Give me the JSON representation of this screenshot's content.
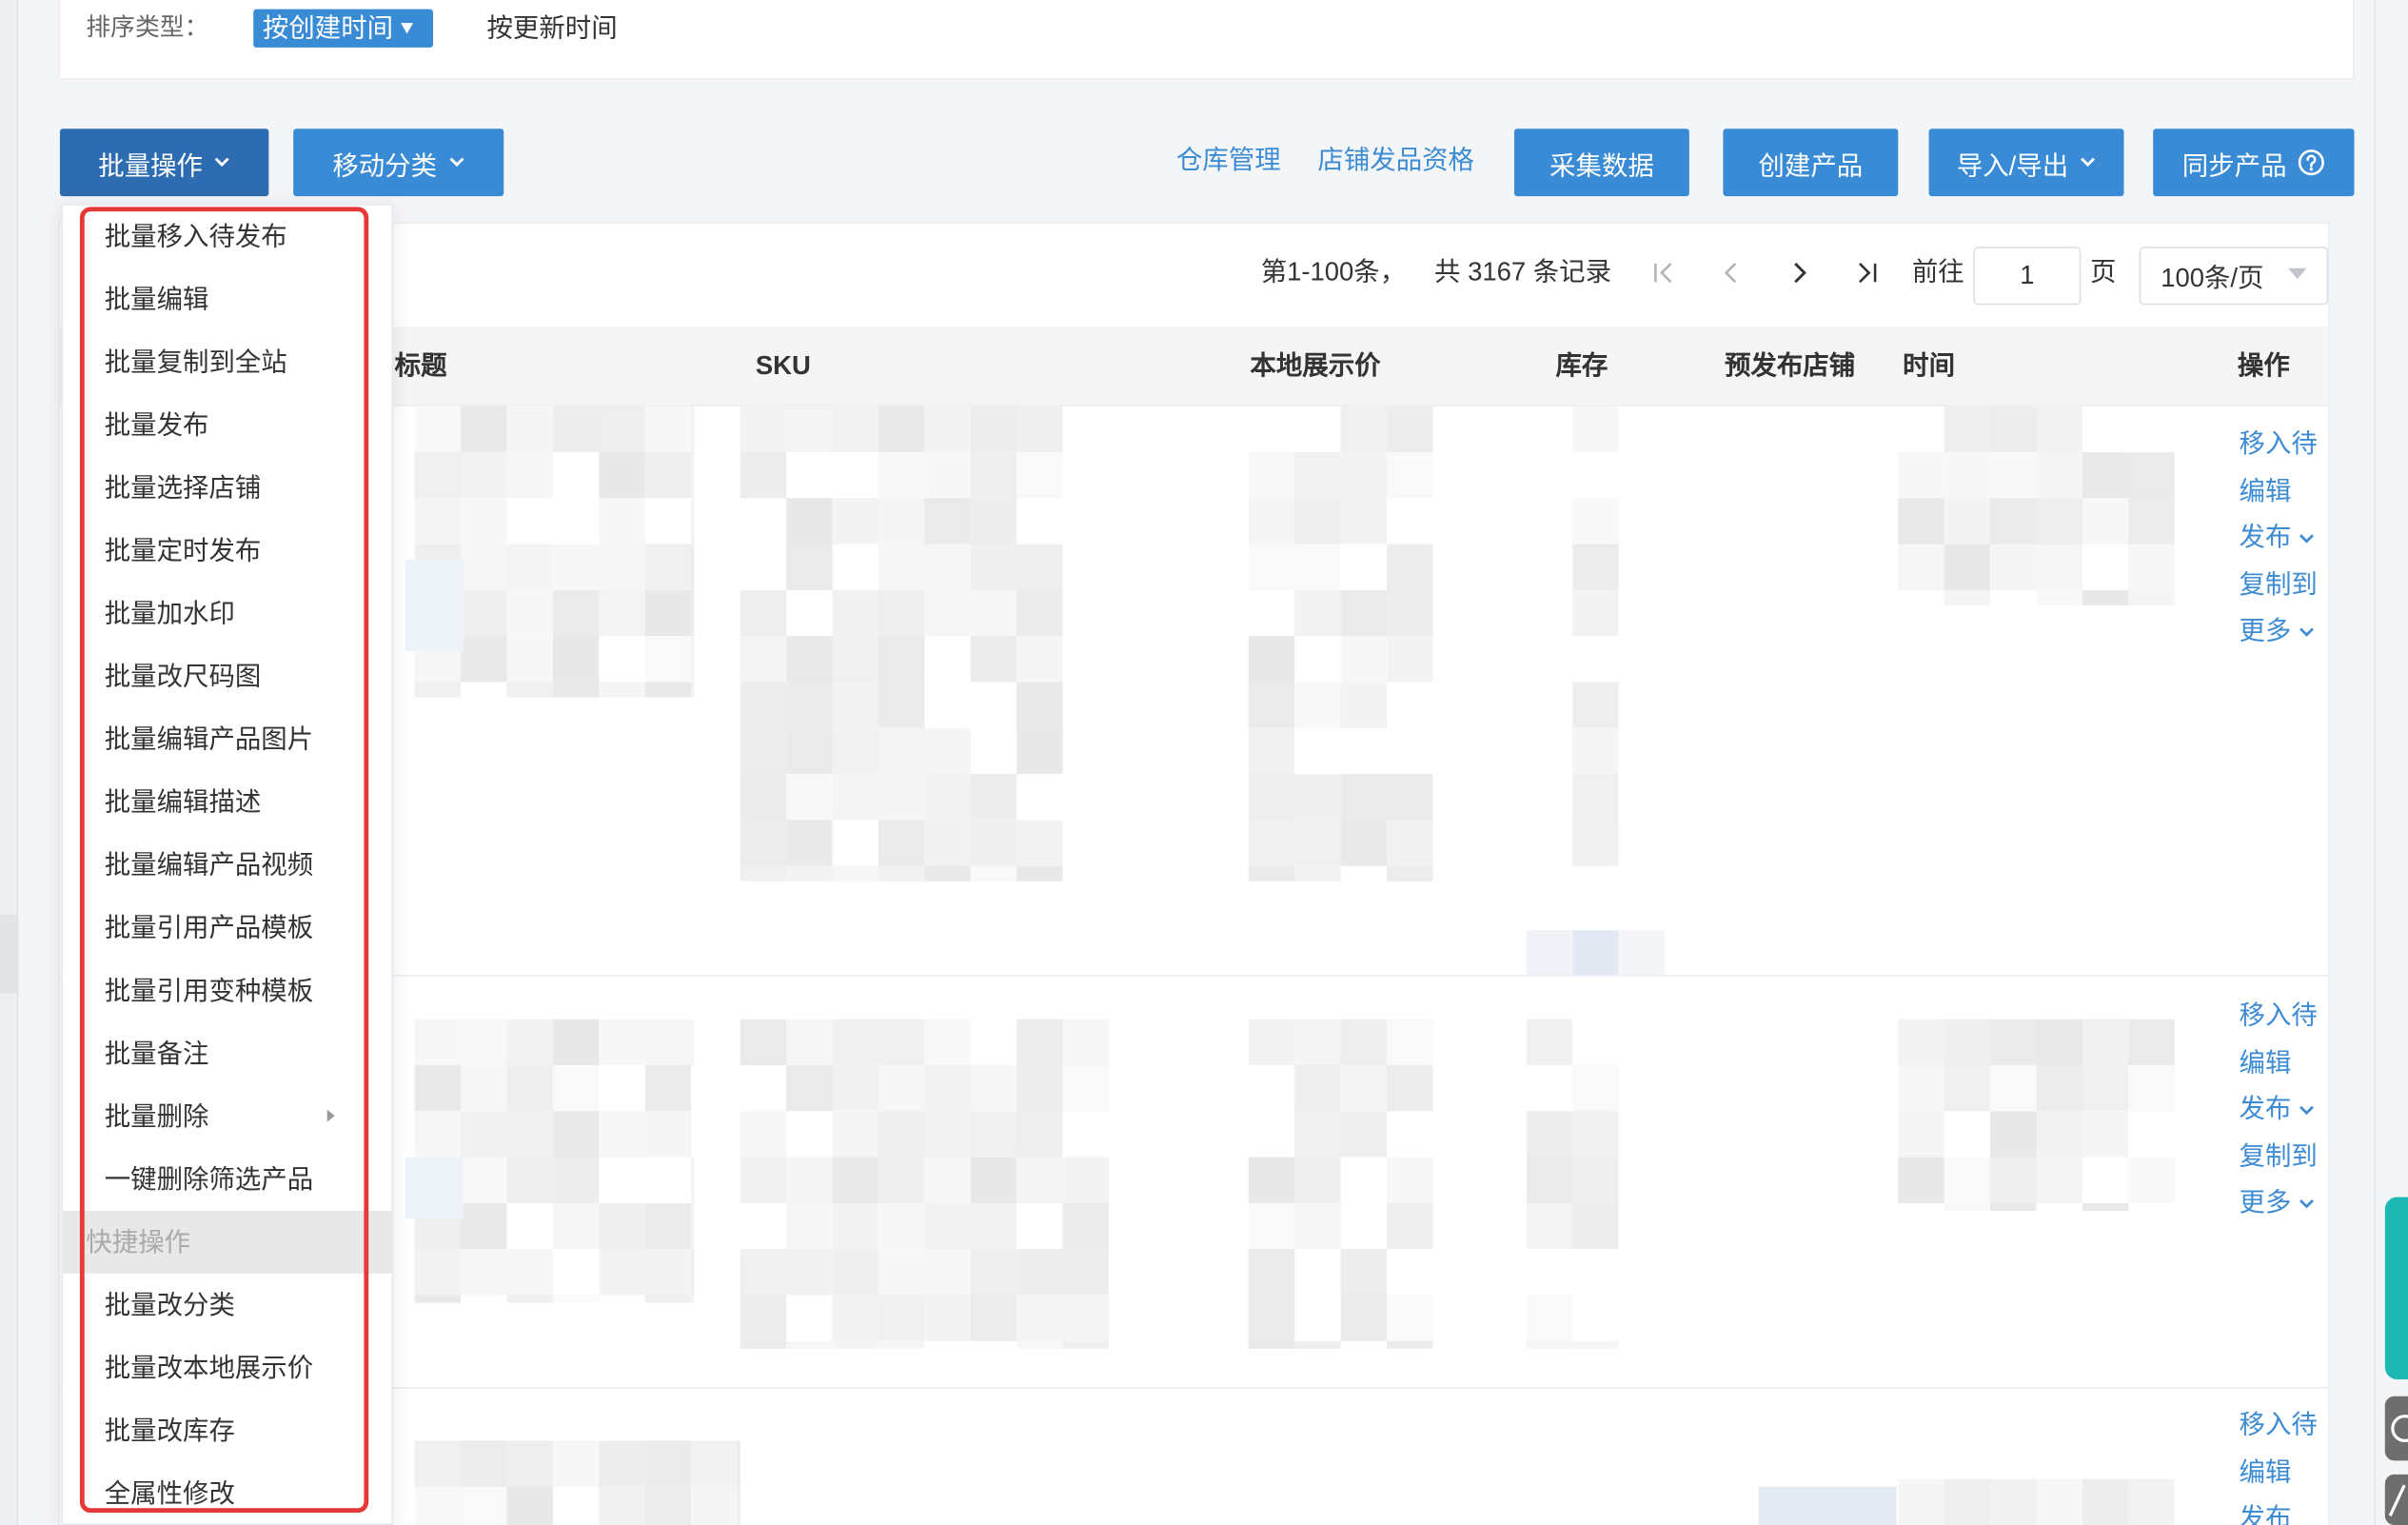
{
  "sort": {
    "label": "排序类型：",
    "active": "按创建时间",
    "other": "按更新时间"
  },
  "toolbar": {
    "batch_ops": "批量操作",
    "move_category": "移动分类",
    "warehouse_link": "仓库管理",
    "store_qualification_link": "店铺发品资格",
    "collect_data": "采集数据",
    "create_product": "创建产品",
    "import_export": "导入/导出",
    "sync_products": "同步产品"
  },
  "pagination": {
    "range": "第1-100条，",
    "total": "共 3167 条记录",
    "goto_label": "前往",
    "page_value": "1",
    "page_unit": "页",
    "page_size": "100条/页"
  },
  "table": {
    "columns": [
      "标题",
      "SKU",
      "本地展示价",
      "库存",
      "预发布店铺",
      "时间",
      "操作"
    ]
  },
  "row_actions": [
    {
      "move": "移入待",
      "edit": "编辑",
      "publish": "发布",
      "copy": "复制到",
      "more": "更多"
    },
    {
      "move": "移入待",
      "edit": "编辑",
      "publish": "发布",
      "copy": "复制到",
      "more": "更多"
    },
    {
      "move": "移入待",
      "edit": "编辑",
      "publish": "发布"
    }
  ],
  "batch_menu": {
    "items": [
      "批量移入待发布",
      "批量编辑",
      "批量复制到全站",
      "批量发布",
      "批量选择店铺",
      "批量定时发布",
      "批量加水印",
      "批量改尺码图",
      "批量编辑产品图片",
      "批量编辑描述",
      "批量编辑产品视频",
      "批量引用产品模板",
      "批量引用变种模板",
      "批量备注",
      "批量删除",
      "一键删除筛选产品"
    ],
    "section_label": "快捷操作",
    "quick_items": [
      "批量改分类",
      "批量改本地展示价",
      "批量改库存",
      "全属性修改"
    ]
  },
  "icons": {
    "dropdown": "chevron-down-icon",
    "help": "help-circle-icon",
    "first_page": "first-page-icon",
    "prev_page": "chevron-left-icon",
    "next_page": "chevron-right-icon",
    "last_page": "last-page-icon",
    "submenu": "caret-right-icon"
  },
  "colors": {
    "primary": "#3a8bd6",
    "primary_dark": "#2d6cb1",
    "link": "#3d8bd3",
    "annotation": "#e53935",
    "teal": "#1db8b4"
  }
}
